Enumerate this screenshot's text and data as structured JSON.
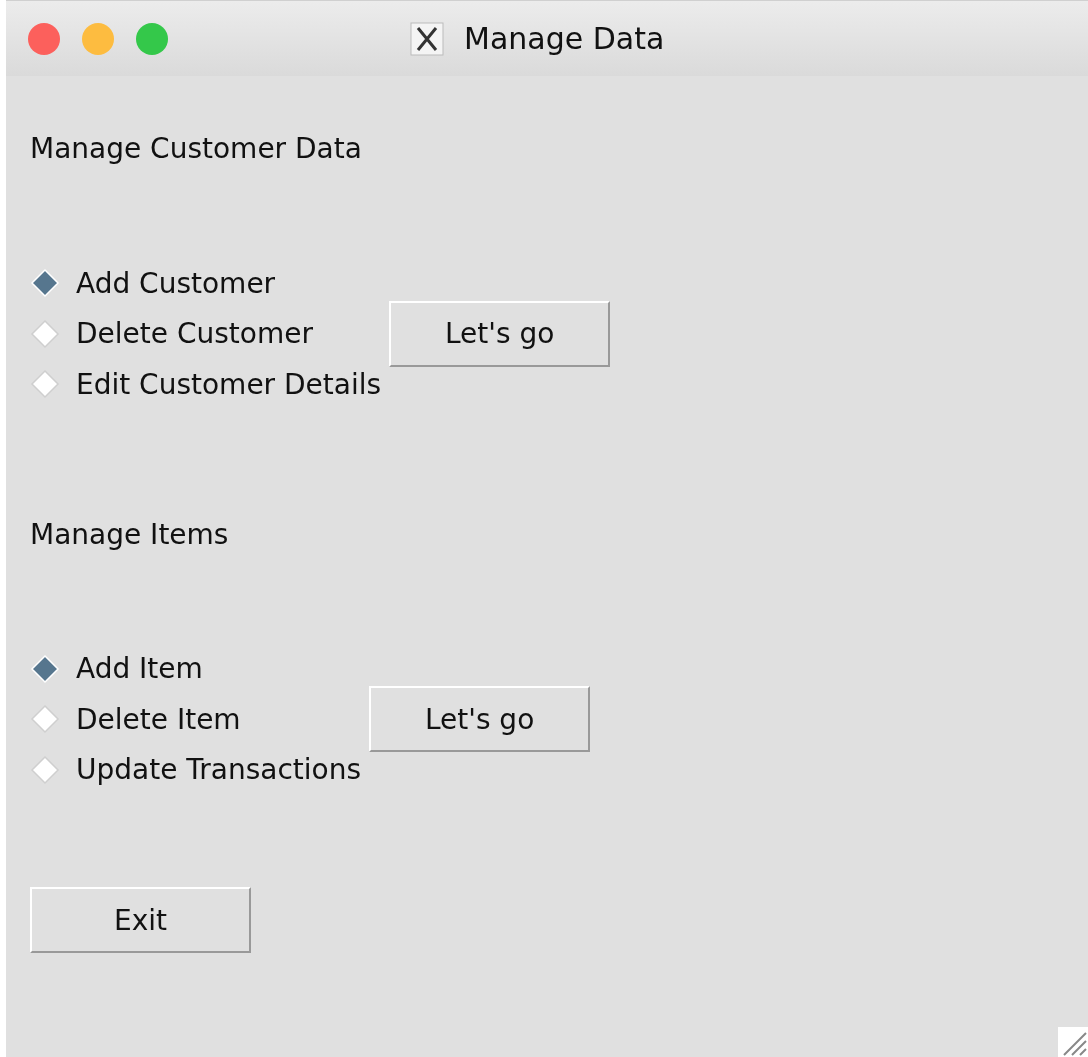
{
  "window": {
    "title": "Manage Data"
  },
  "sections": [
    {
      "title": "Manage Customer Data",
      "options": [
        {
          "label": "Add Customer",
          "selected": true
        },
        {
          "label": "Delete Customer",
          "selected": false
        },
        {
          "label": "Edit Customer Details",
          "selected": false
        }
      ],
      "button": "Let's go"
    },
    {
      "title": "Manage Items",
      "options": [
        {
          "label": "Add Item",
          "selected": true
        },
        {
          "label": "Delete Item",
          "selected": false
        },
        {
          "label": "Update Transactions",
          "selected": false
        }
      ],
      "button": "Let's go"
    }
  ],
  "exit_button": "Exit"
}
